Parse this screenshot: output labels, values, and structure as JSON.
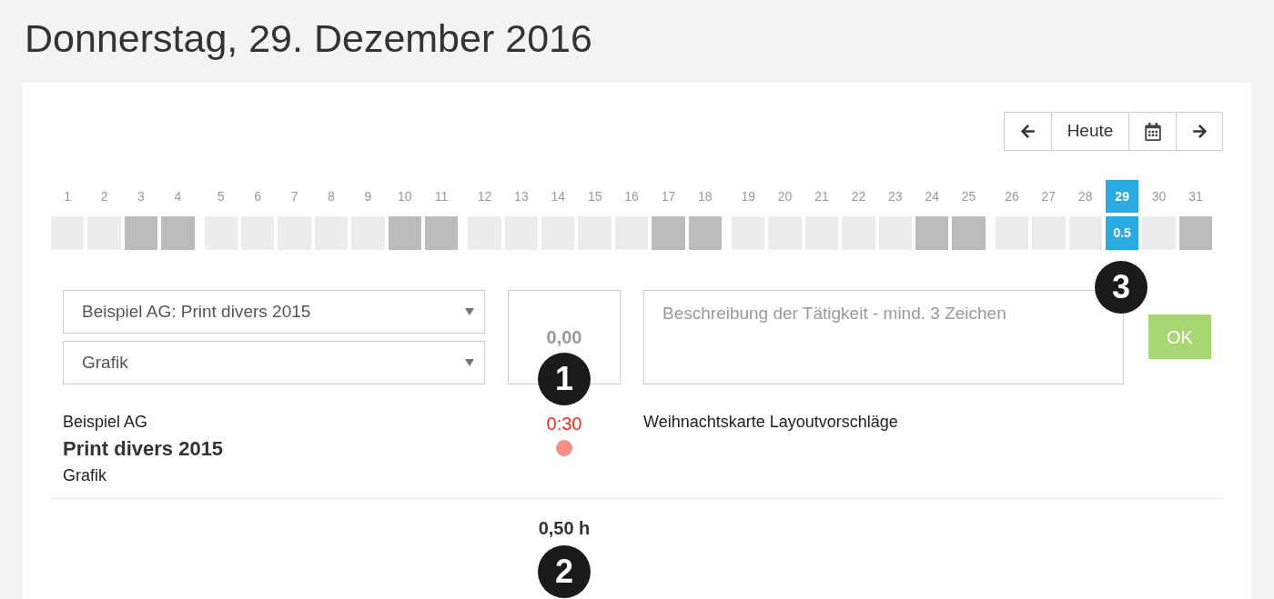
{
  "page": {
    "title": "Donnerstag, 29. Dezember 2016"
  },
  "nav": {
    "buttons": [
      {
        "kind": "prev"
      },
      {
        "kind": "today",
        "label": "Heute"
      },
      {
        "kind": "calendar"
      },
      {
        "kind": "next"
      }
    ]
  },
  "calendar": {
    "weeks": [
      {
        "days": [
          {
            "label": "1",
            "weekend": false,
            "selected": false
          },
          {
            "label": "2",
            "weekend": false,
            "selected": false
          },
          {
            "label": "3",
            "weekend": true,
            "selected": false
          },
          {
            "label": "4",
            "weekend": true,
            "selected": false
          }
        ]
      },
      {
        "days": [
          {
            "label": "5",
            "weekend": false,
            "selected": false
          },
          {
            "label": "6",
            "weekend": false,
            "selected": false
          },
          {
            "label": "7",
            "weekend": false,
            "selected": false
          },
          {
            "label": "8",
            "weekend": false,
            "selected": false
          },
          {
            "label": "9",
            "weekend": false,
            "selected": false
          },
          {
            "label": "10",
            "weekend": true,
            "selected": false
          },
          {
            "label": "11",
            "weekend": true,
            "selected": false
          }
        ]
      },
      {
        "days": [
          {
            "label": "12",
            "weekend": false,
            "selected": false
          },
          {
            "label": "13",
            "weekend": false,
            "selected": false
          },
          {
            "label": "14",
            "weekend": false,
            "selected": false
          },
          {
            "label": "15",
            "weekend": false,
            "selected": false
          },
          {
            "label": "16",
            "weekend": false,
            "selected": false
          },
          {
            "label": "17",
            "weekend": true,
            "selected": false
          },
          {
            "label": "18",
            "weekend": true,
            "selected": false
          }
        ]
      },
      {
        "days": [
          {
            "label": "19",
            "weekend": false,
            "selected": false
          },
          {
            "label": "20",
            "weekend": false,
            "selected": false
          },
          {
            "label": "21",
            "weekend": false,
            "selected": false
          },
          {
            "label": "22",
            "weekend": false,
            "selected": false
          },
          {
            "label": "23",
            "weekend": false,
            "selected": false
          },
          {
            "label": "24",
            "weekend": true,
            "selected": false
          },
          {
            "label": "25",
            "weekend": true,
            "selected": false
          }
        ]
      },
      {
        "days": [
          {
            "label": "26",
            "weekend": false,
            "selected": false
          },
          {
            "label": "27",
            "weekend": false,
            "selected": false
          },
          {
            "label": "28",
            "weekend": false,
            "selected": false
          },
          {
            "label": "29",
            "weekend": false,
            "selected": true,
            "value": "0.5"
          },
          {
            "label": "30",
            "weekend": false,
            "selected": false
          },
          {
            "label": "31",
            "weekend": true,
            "selected": false
          }
        ]
      }
    ]
  },
  "form": {
    "project_select": {
      "value": "Beispiel AG: Print divers 2015"
    },
    "category_select": {
      "value": "Grafik"
    },
    "hours": {
      "placeholder": "0,00",
      "callout": "1"
    },
    "description": {
      "placeholder": "Beschreibung der Tätigkeit - mind. 3 Zeichen",
      "callout": "3"
    },
    "submit": {
      "label": "OK"
    }
  },
  "entries": [
    {
      "client": "Beispiel AG",
      "project": "Print divers 2015",
      "category": "Grafik",
      "duration": "0:30",
      "description": "Weihnachtskarte Layoutvorschläge"
    }
  ],
  "total": {
    "value": "0,50 h",
    "callout": "2"
  }
}
